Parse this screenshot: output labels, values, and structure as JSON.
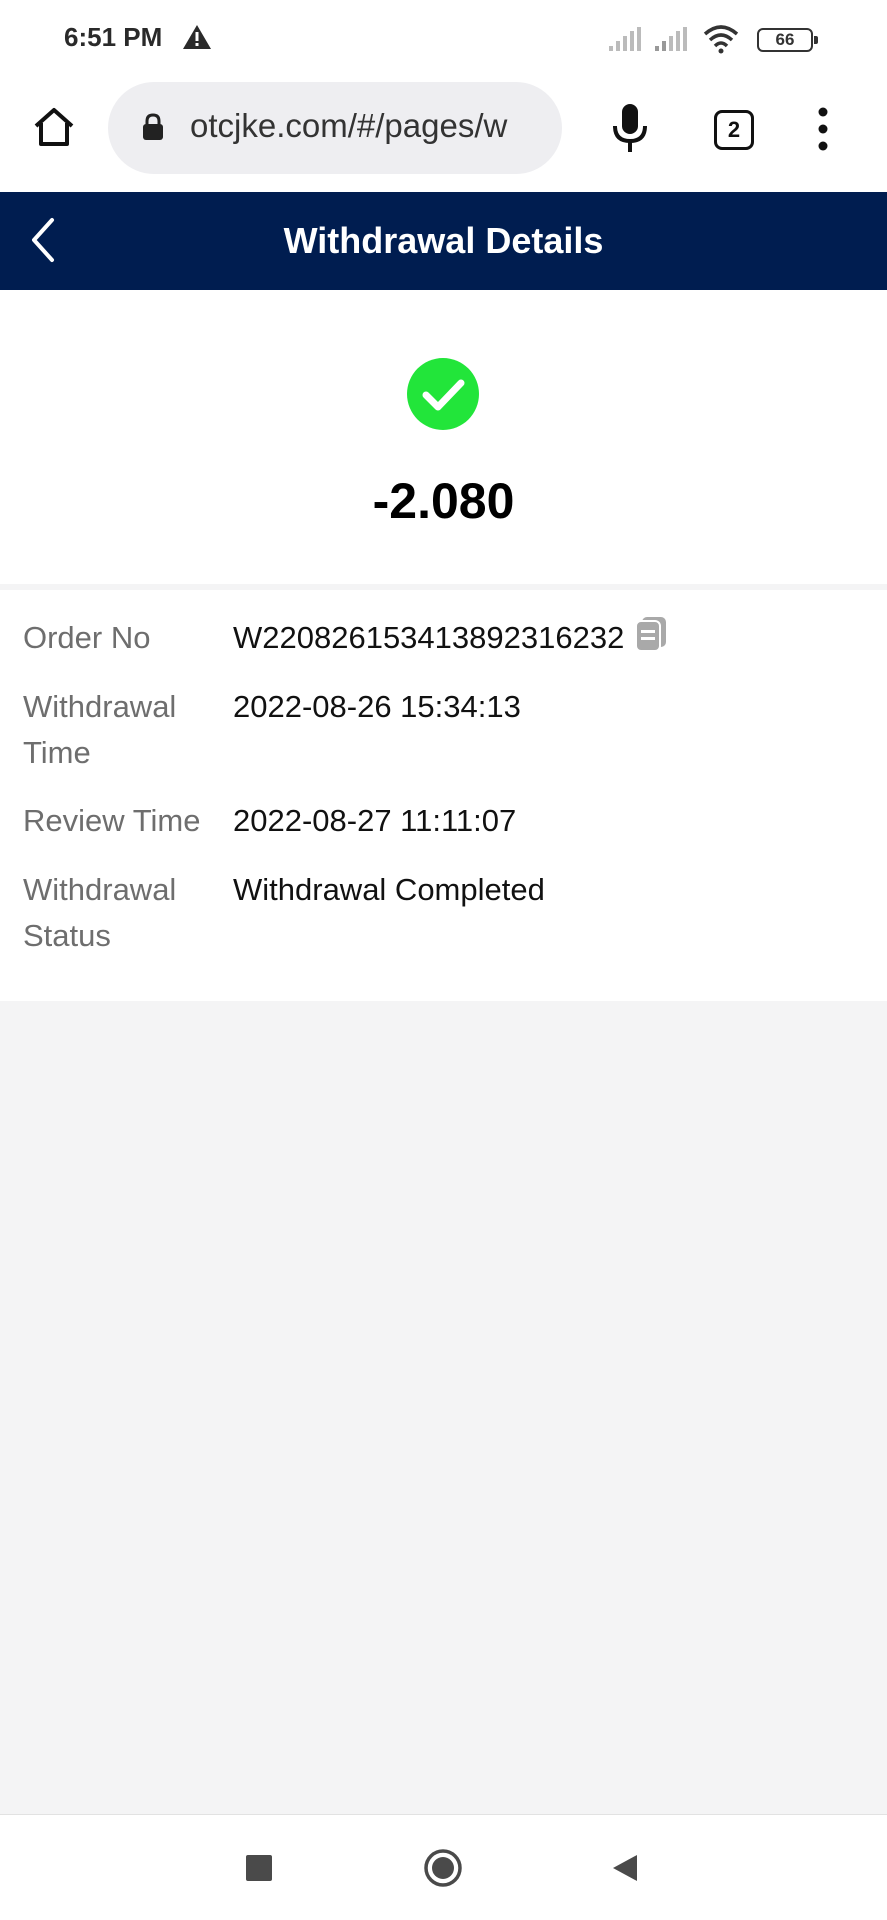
{
  "status_bar": {
    "time": "6:51 PM",
    "battery": "66",
    "icons": [
      "warning-icon",
      "signal-icon",
      "signal-icon",
      "wifi-icon",
      "battery-icon"
    ]
  },
  "browser": {
    "url": "otcjke.com/#/pages/w",
    "tab_count": "2",
    "icons": [
      "home-icon",
      "lock-icon",
      "mic-icon",
      "tabs-icon",
      "more-vert-icon"
    ]
  },
  "header": {
    "title": "Withdrawal Details",
    "background": "#001d50"
  },
  "summary": {
    "amount": "-2.080",
    "status_icon": "check-circle-icon",
    "status_color": "#22e53a"
  },
  "details": [
    {
      "label": "Order No",
      "value": "W2208261534138923162​32"
    },
    {
      "label": "Withdrawal Time",
      "value": "2022-08-26 15:34:13"
    },
    {
      "label": "Review Time",
      "value": "2022-08-27 11:11:07"
    },
    {
      "label": "Withdrawal Status",
      "value": "Withdrawal Completed"
    }
  ],
  "nav": {
    "icons": [
      "recents-icon",
      "home-circle-icon",
      "back-triangle-icon"
    ]
  }
}
